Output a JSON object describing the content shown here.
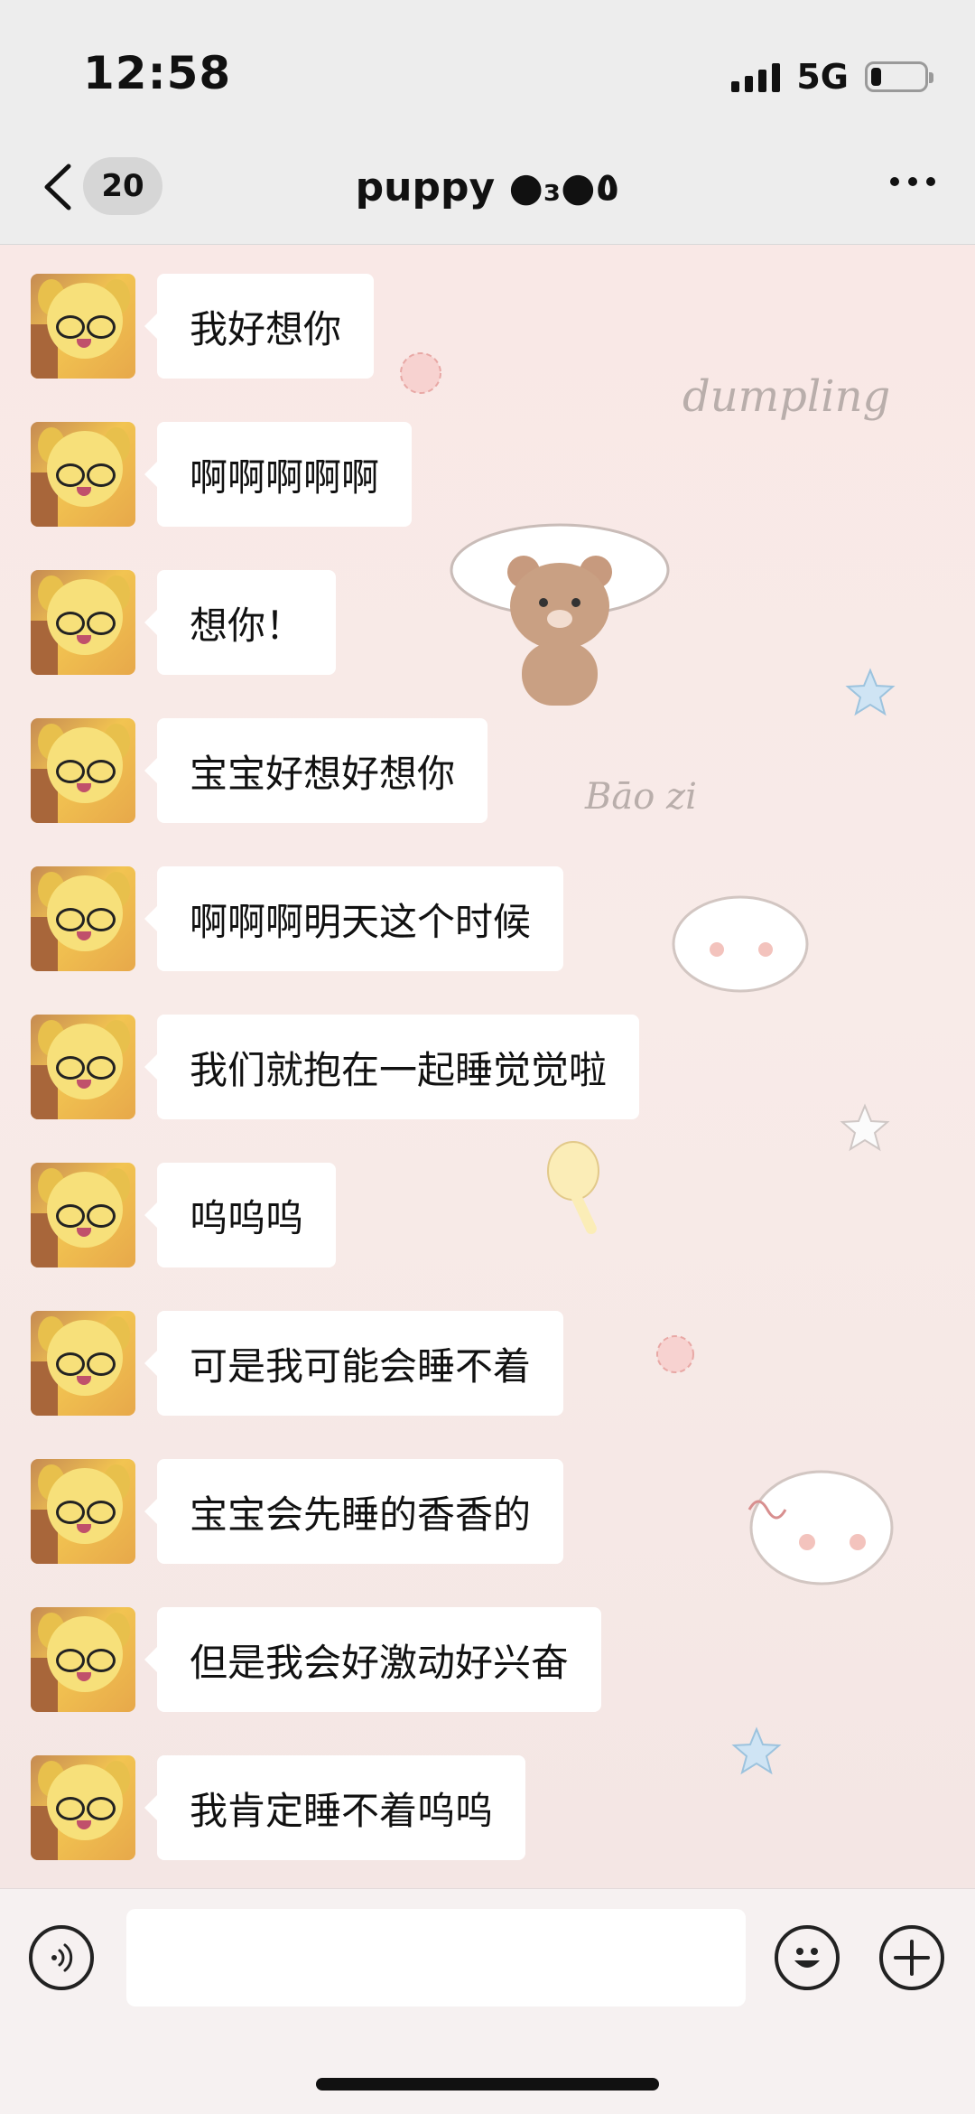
{
  "status_bar": {
    "time": "12:58",
    "network": "5G",
    "battery_level": 0.2
  },
  "header": {
    "back_icon": "chevron-left-icon",
    "unread_count": "20",
    "title": "puppy ●₃●٥",
    "more_icon": "more-dots-icon"
  },
  "background": {
    "text_dumpling": "dumpling",
    "text_baozi": "Bāo zi"
  },
  "messages": [
    {
      "text": "我好想你"
    },
    {
      "text": "啊啊啊啊啊"
    },
    {
      "text": "想你！"
    },
    {
      "text": "宝宝好想好想你"
    },
    {
      "text": "啊啊啊明天这个时候"
    },
    {
      "text": "我们就抱在一起睡觉觉啦"
    },
    {
      "text": "呜呜呜"
    },
    {
      "text": "可是我可能会睡不着"
    },
    {
      "text": "宝宝会先睡的香香的"
    },
    {
      "text": "但是我会好激动好兴奋"
    },
    {
      "text": "我肯定睡不着呜呜"
    }
  ],
  "input_bar": {
    "voice_icon": "voice-icon",
    "input_value": "",
    "emoji_icon": "emoji-icon",
    "plus_icon": "plus-icon"
  },
  "colors": {
    "header_bg": "#ededed",
    "chat_bg": "#f9e8e6",
    "bubble_bg": "#ffffff"
  }
}
